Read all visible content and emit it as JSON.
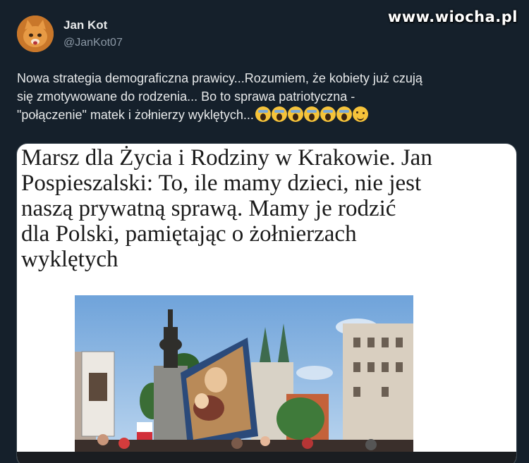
{
  "watermark": "www.wiocha.pl",
  "author": {
    "display_name": "Jan Kot",
    "handle": "@JanKot07",
    "avatar_icon": "orange-cat-avatar"
  },
  "tweet": {
    "text_line1": "Nowa strategia demograficzna prawicy...Rozumiem, że kobiety już czują",
    "text_line2": "się zmotywowane do rodzenia... Bo to  sprawa patriotyczna -",
    "text_line3": "\"połączenie\" matek i żołnierzy wyklętych...",
    "emojis": [
      "scream-icon",
      "scream-icon",
      "scream-icon",
      "scream-icon",
      "scream-icon",
      "scream-icon",
      "wink-icon"
    ]
  },
  "media": {
    "headline_line1": "Marsz dla Życia i Rodziny w Krakowie. Jan",
    "headline_line2": "Pospieszalski: To, ile mamy dzieci, nie jest",
    "headline_line3": "naszą prywatną sprawą. Mamy je rodzić",
    "headline_line4": "dla Polski, pamiętając o żołnierzach",
    "headline_line5": "wyklętych",
    "photo_subject": "march-crowd-photo"
  },
  "colors": {
    "background": "#15202b",
    "text": "#e7e9ea",
    "muted": "#8b98a5"
  }
}
